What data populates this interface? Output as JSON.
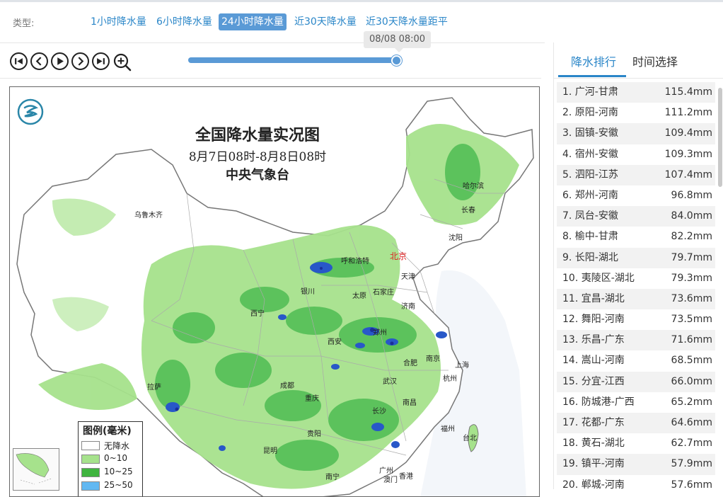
{
  "type_bar": {
    "label": "类型:",
    "tabs": [
      {
        "label": "1小时降水量"
      },
      {
        "label": "6小时降水量"
      },
      {
        "label": "24小时降水量"
      },
      {
        "label": "近30天降水量"
      },
      {
        "label": "近30天降水量距平"
      }
    ],
    "active_tab": 2
  },
  "player": {
    "buttons": [
      "first-icon",
      "prev-icon",
      "play-icon",
      "next-icon",
      "last-icon",
      "zoom-in-icon"
    ],
    "progress": 1.0,
    "current_time": "08/08 08:00"
  },
  "map": {
    "title": "全国降水量实况图",
    "subtitle": "8月7日08时-8月8日08时",
    "org": "中央气象台",
    "cities": [
      {
        "name": "乌鲁木齐"
      },
      {
        "name": "哈尔滨"
      },
      {
        "name": "长春"
      },
      {
        "name": "沈阳"
      },
      {
        "name": "北京"
      },
      {
        "name": "呼和浩特"
      },
      {
        "name": "天津"
      },
      {
        "name": "银川"
      },
      {
        "name": "太原"
      },
      {
        "name": "石家庄"
      },
      {
        "name": "济南"
      },
      {
        "name": "西宁"
      },
      {
        "name": "郑州"
      },
      {
        "name": "西安"
      },
      {
        "name": "合肥"
      },
      {
        "name": "南京"
      },
      {
        "name": "上海"
      },
      {
        "name": "成都"
      },
      {
        "name": "武汉"
      },
      {
        "name": "杭州"
      },
      {
        "name": "拉萨"
      },
      {
        "name": "重庆"
      },
      {
        "name": "长沙"
      },
      {
        "name": "南昌"
      },
      {
        "name": "福州"
      },
      {
        "name": "贵阳"
      },
      {
        "name": "台北"
      },
      {
        "name": "昆明"
      },
      {
        "name": "广州"
      },
      {
        "name": "南宁"
      },
      {
        "name": "香港"
      },
      {
        "name": "澳门"
      }
    ],
    "legend": {
      "title": "图例(毫米)",
      "items": [
        {
          "label": "无降水",
          "color": "#ffffff"
        },
        {
          "label": "0~10",
          "color": "#a6e28c"
        },
        {
          "label": "10~25",
          "color": "#3fb43f"
        },
        {
          "label": "25~50",
          "color": "#62b8f2"
        }
      ]
    },
    "colors": {
      "green_light": "#a6e28c",
      "green_mid": "#5cc25c",
      "blue": "#2858c8",
      "dark_blue": "#1a2f9a"
    }
  },
  "right_panel": {
    "tabs": [
      {
        "label": "降水排行"
      },
      {
        "label": "时间选择"
      }
    ],
    "active_tab": 0,
    "ranking": [
      {
        "name": "1. 广河-甘肃",
        "value": "115.4mm"
      },
      {
        "name": "2. 原阳-河南",
        "value": "111.2mm"
      },
      {
        "name": "3. 固镇-安徽",
        "value": "109.4mm"
      },
      {
        "name": "4. 宿州-安徽",
        "value": "109.3mm"
      },
      {
        "name": "5. 泗阳-江苏",
        "value": "107.4mm"
      },
      {
        "name": "6. 郑州-河南",
        "value": "96.8mm"
      },
      {
        "name": "7. 凤台-安徽",
        "value": "84.0mm"
      },
      {
        "name": "8. 榆中-甘肃",
        "value": "82.2mm"
      },
      {
        "name": "9. 长阳-湖北",
        "value": "79.7mm"
      },
      {
        "name": "10. 夷陵区-湖北",
        "value": "79.3mm"
      },
      {
        "name": "11. 宜昌-湖北",
        "value": "73.6mm"
      },
      {
        "name": "12. 舞阳-河南",
        "value": "73.5mm"
      },
      {
        "name": "13. 乐昌-广东",
        "value": "71.6mm"
      },
      {
        "name": "14. 嵩山-河南",
        "value": "68.5mm"
      },
      {
        "name": "15. 分宜-江西",
        "value": "66.0mm"
      },
      {
        "name": "16. 防城港-广西",
        "value": "65.2mm"
      },
      {
        "name": "17. 花都-广东",
        "value": "64.6mm"
      },
      {
        "name": "18. 黄石-湖北",
        "value": "62.7mm"
      },
      {
        "name": "19. 镇平-河南",
        "value": "57.9mm"
      },
      {
        "name": "20. 郸城-河南",
        "value": "57.6mm"
      }
    ]
  }
}
